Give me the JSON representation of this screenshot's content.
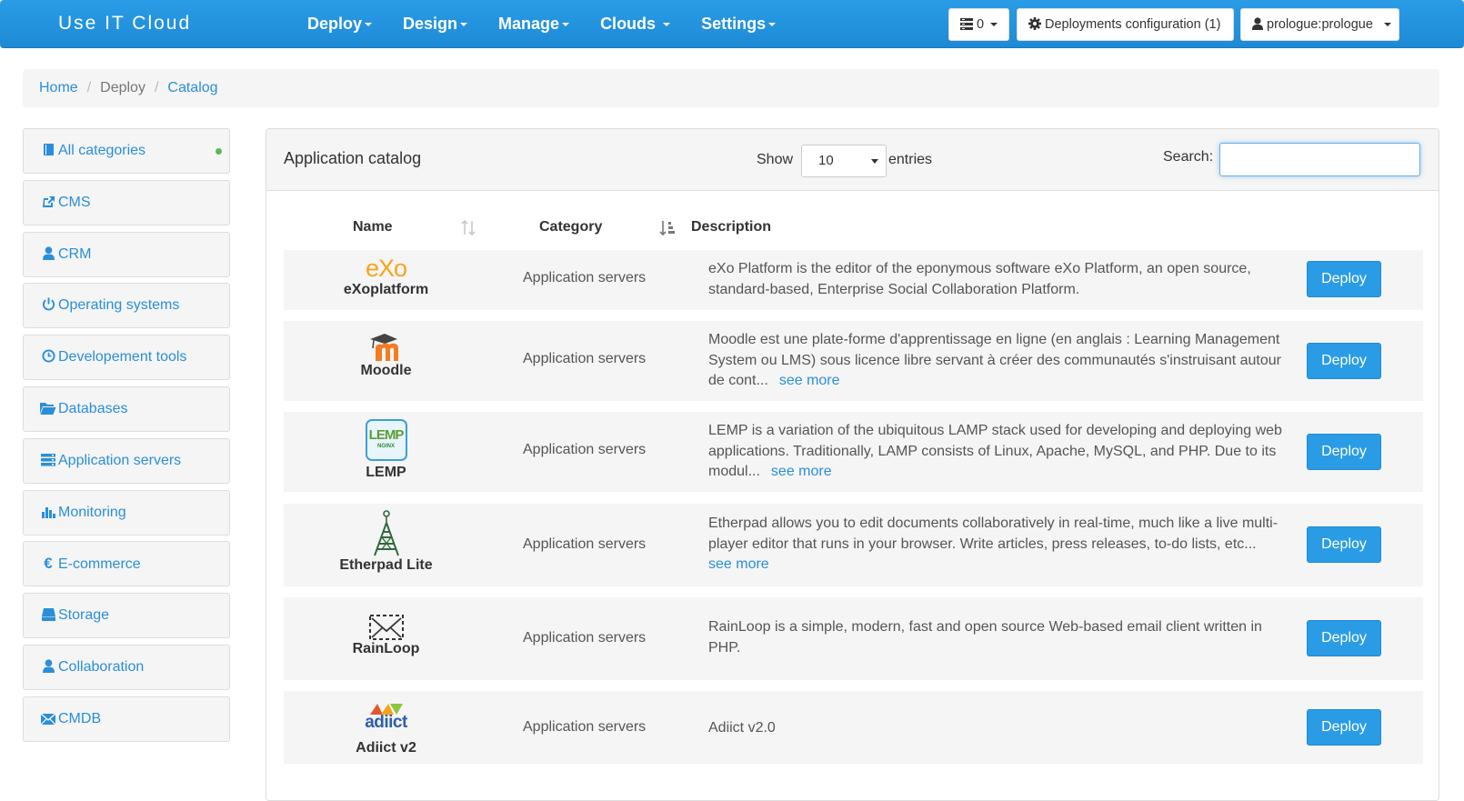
{
  "navbar": {
    "brand": "Use IT Cloud",
    "menu": [
      "Deploy",
      "Design",
      "Manage",
      "Clouds",
      "Settings"
    ],
    "queue_count": "0",
    "deployments_config": "Deployments configuration (1)",
    "user": "prologue:prologue"
  },
  "breadcrumb": {
    "home": "Home",
    "deploy": "Deploy",
    "catalog": "Catalog",
    "sep": "/"
  },
  "sidebar": {
    "items": [
      {
        "label": "All categories",
        "icon": "book-icon"
      },
      {
        "label": "CMS",
        "icon": "share-icon"
      },
      {
        "label": "CRM",
        "icon": "user-icon"
      },
      {
        "label": "Operating systems",
        "icon": "power-icon"
      },
      {
        "label": "Developement tools",
        "icon": "clock-icon"
      },
      {
        "label": "Databases",
        "icon": "folder-open-icon"
      },
      {
        "label": "Application servers",
        "icon": "server-icon"
      },
      {
        "label": "Monitoring",
        "icon": "bar-chart-icon"
      },
      {
        "label": "E-commerce",
        "icon": "euro-icon"
      },
      {
        "label": "Storage",
        "icon": "hdd-icon"
      },
      {
        "label": "Collaboration",
        "icon": "user-icon"
      },
      {
        "label": "CMDB",
        "icon": "envelope-icon"
      }
    ]
  },
  "catalog": {
    "title": "Application catalog",
    "show_label": "Show",
    "entries_value": "10",
    "entries_label": "entries",
    "search_label": "Search:",
    "search_value": "",
    "columns": {
      "name": "Name",
      "category": "Category",
      "description": "Description"
    },
    "deploy_label": "Deploy",
    "see_more": "see more",
    "rows": [
      {
        "name": "eXoplatform",
        "logo_text": "eXo",
        "category": "Application servers",
        "desc_lines": [
          "eXo Platform is the editor of the eponymous software eXo Platform, an open source,",
          "standard-based, Enterprise Social Collaboration Platform."
        ]
      },
      {
        "name": "Moodle",
        "logo_text": "m",
        "category": "Application servers",
        "desc_lines": [
          "Moodle est une plate-forme d'apprentissage en ligne (en anglais : Learning Management",
          "System ou LMS) sous licence libre servant à créer des communautés s'instruisant autour",
          "de cont..."
        ]
      },
      {
        "name": "LEMP",
        "logo_text": "LEMP",
        "logo_subtext": "NGINX",
        "category": "Application servers",
        "desc_lines": [
          "LEMP is a variation of the ubiquitous LAMP stack used for developing and deploying web",
          "applications. Traditionally, LAMP consists of Linux, Apache, MySQL, and PHP. Due to its",
          "modul..."
        ]
      },
      {
        "name": "Etherpad Lite",
        "category": "Application servers",
        "desc_lines": [
          "Etherpad allows you to edit documents collaboratively in real-time, much like a live multi-",
          "player editor that runs in your browser. Write articles, press releases, to-do lists, etc..."
        ]
      },
      {
        "name": "RainLoop",
        "category": "Application servers",
        "desc_lines": [
          "RainLoop is a simple, modern, fast and open source Web-based email client written in",
          "PHP."
        ]
      },
      {
        "name": "Adiict v2",
        "logo_text": "adiict",
        "category": "Application servers",
        "desc_lines": [
          "Adiict v2.0"
        ]
      }
    ]
  },
  "colors": {
    "accent": "#2a9ce6",
    "link": "#2a8fd8",
    "status_green": "#5cb85c",
    "panel_bg": "#f5f5f5"
  }
}
